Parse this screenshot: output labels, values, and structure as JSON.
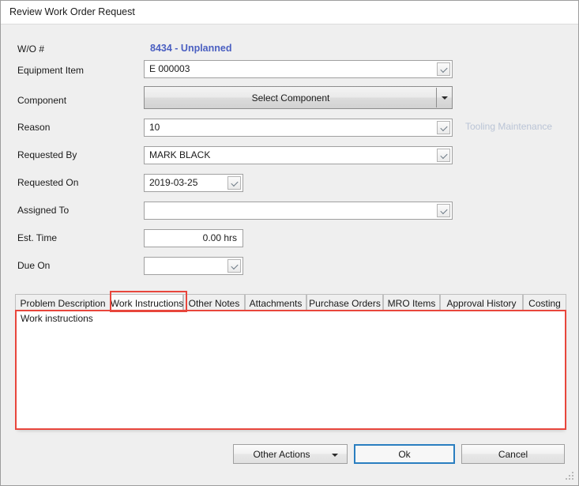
{
  "window": {
    "title": "Review Work Order Request"
  },
  "form": {
    "wo_number": {
      "label": "W/O #",
      "value": "8434 - Unplanned"
    },
    "equipment_item": {
      "label": "Equipment Item",
      "value": "E 000003"
    },
    "component": {
      "label": "Component",
      "button_label": "Select Component"
    },
    "reason": {
      "label": "Reason",
      "value": "10",
      "note": "Tooling Maintenance"
    },
    "requested_by": {
      "label": "Requested By",
      "value": "MARK BLACK"
    },
    "requested_on": {
      "label": "Requested On",
      "value": "2019-03-25"
    },
    "assigned_to": {
      "label": "Assigned To",
      "value": ""
    },
    "est_time": {
      "label": "Est. Time",
      "value": "0.00 hrs"
    },
    "due_on": {
      "label": "Due On",
      "value": ""
    }
  },
  "tabs": {
    "selected_index": 1,
    "items": [
      {
        "label": "Problem Description"
      },
      {
        "label": "Work Instructions"
      },
      {
        "label": "Other Notes"
      },
      {
        "label": "Attachments"
      },
      {
        "label": "Purchase Orders"
      },
      {
        "label": "MRO Items"
      },
      {
        "label": "Approval History"
      },
      {
        "label": "Costing"
      }
    ]
  },
  "tab_panel": {
    "content": "Work instructions"
  },
  "footer": {
    "other_actions_label": "Other Actions",
    "ok_label": "Ok",
    "cancel_label": "Cancel"
  },
  "colors": {
    "accent_blue": "#4a5fc1",
    "focus_blue": "#2a7ec0",
    "highlight_red": "#e8463c",
    "note_gray": "#bac4d6"
  }
}
